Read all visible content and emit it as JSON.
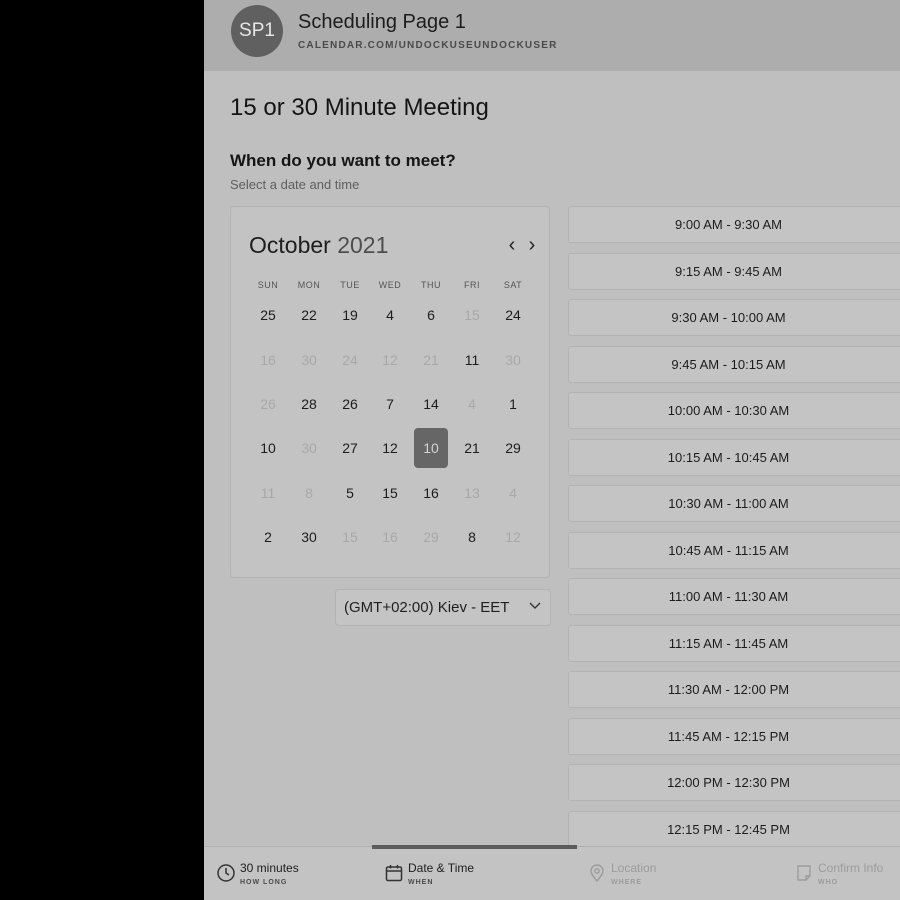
{
  "header": {
    "avatar": "SP1",
    "page_name": "Scheduling Page 1",
    "page_url": "CALENDAR.COM/UNDOCKUSEUNDOCKUSER"
  },
  "meeting_title": "15 or 30 Minute Meeting",
  "prompt": {
    "title": "When do you want to meet?",
    "hint": "Select a date and time"
  },
  "calendar": {
    "month": "October",
    "year": "2021",
    "weekdays": [
      "SUN",
      "MON",
      "TUE",
      "WED",
      "THU",
      "FRI",
      "SAT"
    ],
    "weeks": [
      [
        {
          "d": "25",
          "on": true
        },
        {
          "d": "22",
          "on": true
        },
        {
          "d": "19",
          "on": true
        },
        {
          "d": "4",
          "on": true
        },
        {
          "d": "6",
          "on": true
        },
        {
          "d": "15",
          "on": false
        },
        {
          "d": "24",
          "on": true
        }
      ],
      [
        {
          "d": "16",
          "on": false
        },
        {
          "d": "30",
          "on": false
        },
        {
          "d": "24",
          "on": false
        },
        {
          "d": "12",
          "on": false
        },
        {
          "d": "21",
          "on": false
        },
        {
          "d": "11",
          "on": true
        },
        {
          "d": "30",
          "on": false
        }
      ],
      [
        {
          "d": "26",
          "on": false
        },
        {
          "d": "28",
          "on": true
        },
        {
          "d": "26",
          "on": true
        },
        {
          "d": "7",
          "on": true
        },
        {
          "d": "14",
          "on": true
        },
        {
          "d": "4",
          "on": false
        },
        {
          "d": "1",
          "on": true
        }
      ],
      [
        {
          "d": "10",
          "on": true
        },
        {
          "d": "30",
          "on": false
        },
        {
          "d": "27",
          "on": true
        },
        {
          "d": "12",
          "on": true
        },
        {
          "d": "10",
          "on": true,
          "selected": true
        },
        {
          "d": "21",
          "on": true
        },
        {
          "d": "29",
          "on": true
        }
      ],
      [
        {
          "d": "11",
          "on": false
        },
        {
          "d": "8",
          "on": false
        },
        {
          "d": "5",
          "on": true
        },
        {
          "d": "15",
          "on": true
        },
        {
          "d": "16",
          "on": true
        },
        {
          "d": "13",
          "on": false
        },
        {
          "d": "4",
          "on": false
        }
      ],
      [
        {
          "d": "2",
          "on": true
        },
        {
          "d": "30",
          "on": true
        },
        {
          "d": "15",
          "on": false
        },
        {
          "d": "16",
          "on": false
        },
        {
          "d": "29",
          "on": false
        },
        {
          "d": "8",
          "on": true
        },
        {
          "d": "12",
          "on": false
        }
      ]
    ]
  },
  "timezone": "(GMT+02:00) Kiev - EET",
  "time_slots": [
    "9:00 AM - 9:30 AM",
    "9:15 AM - 9:45 AM",
    "9:30 AM - 10:00 AM",
    "9:45 AM - 10:15 AM",
    "10:00 AM - 10:30 AM",
    "10:15 AM - 10:45 AM",
    "10:30 AM - 11:00 AM",
    "10:45 AM - 11:15 AM",
    "11:00 AM - 11:30 AM",
    "11:15 AM - 11:45 AM",
    "11:30 AM - 12:00 PM",
    "11:45 AM - 12:15 PM",
    "12:00 PM - 12:30 PM",
    "12:15 PM - 12:45 PM"
  ],
  "footer": {
    "steps": [
      {
        "label": "30 minutes",
        "sub": "HOW LONG",
        "icon": "clock-icon",
        "active": true
      },
      {
        "label": "Date & Time",
        "sub": "WHEN",
        "icon": "calendar-icon",
        "active": true
      },
      {
        "label": "Location",
        "sub": "WHERE",
        "icon": "location-pin-icon",
        "active": false
      },
      {
        "label": "Confirm Info",
        "sub": "WHO",
        "icon": "document-icon",
        "active": false
      }
    ]
  }
}
